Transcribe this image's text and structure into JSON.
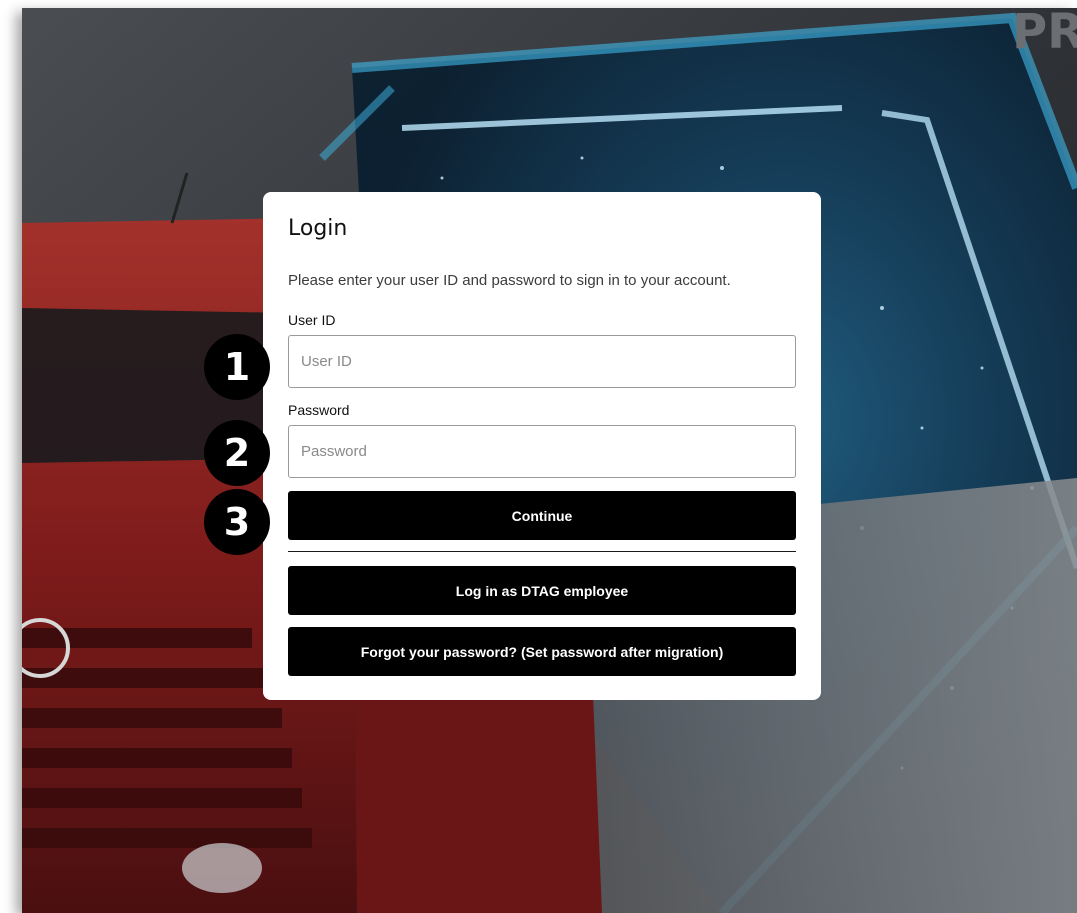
{
  "login": {
    "title": "Login",
    "description": "Please enter your user ID and password to sign in to your account.",
    "user_id_label": "User ID",
    "user_id_placeholder": "User ID",
    "user_id_value": "",
    "password_label": "Password",
    "password_placeholder": "Password",
    "password_value": "",
    "continue_label": "Continue",
    "dtag_label": "Log in as DTAG employee",
    "forgot_label": "Forgot your password? (Set password after migration)"
  },
  "callouts": {
    "step1": "1",
    "step2": "2",
    "step3": "3"
  },
  "background": {
    "scene": "red-truck-with-glowing-hexagon-icon",
    "accent_color": "#3fb8e8",
    "truck_color": "#8e1d1c"
  }
}
